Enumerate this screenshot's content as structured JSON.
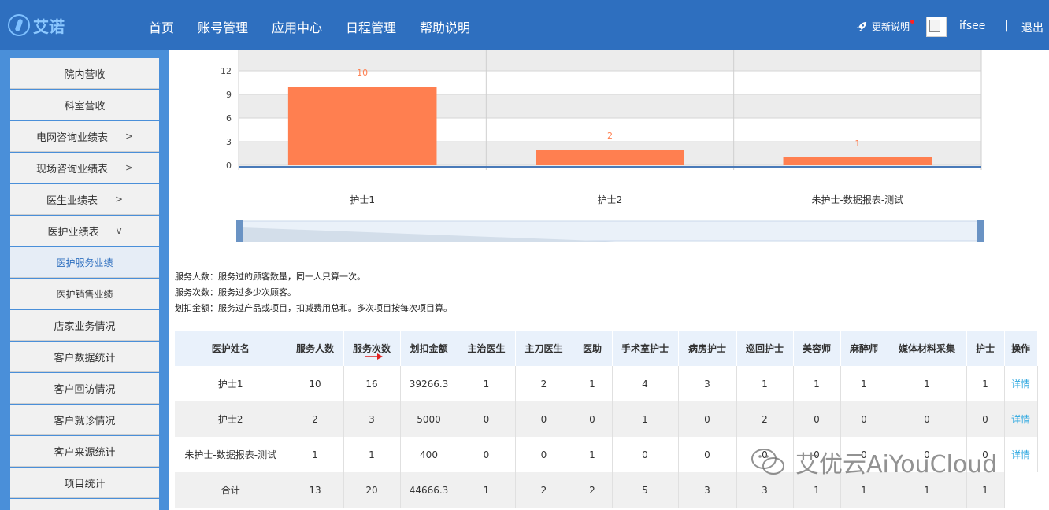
{
  "header": {
    "logo_text": "艾诺",
    "nav": [
      "首页",
      "账号管理",
      "应用中心",
      "日程管理",
      "帮助说明"
    ],
    "update_label": "更新说明",
    "username": "ifsee",
    "separator": "|",
    "logout_label": "退出",
    "brand_color": "#2e6fbf"
  },
  "sidebar": {
    "items": [
      {
        "label": "院内营收",
        "chevron": ""
      },
      {
        "label": "科室营收",
        "chevron": ""
      },
      {
        "label": "电网咨询业绩表",
        "chevron": ">"
      },
      {
        "label": "现场咨询业绩表",
        "chevron": ">"
      },
      {
        "label": "医生业绩表",
        "chevron": ">"
      },
      {
        "label": "医护业绩表",
        "chevron": "v"
      },
      {
        "label": "医护服务业绩",
        "chevron": "",
        "active": true
      },
      {
        "label": "医护销售业绩",
        "chevron": ""
      },
      {
        "label": "店家业务情况",
        "chevron": ""
      },
      {
        "label": "客户数据统计",
        "chevron": ""
      },
      {
        "label": "客户回访情况",
        "chevron": ""
      },
      {
        "label": "客户就诊情况",
        "chevron": ""
      },
      {
        "label": "客户来源统计",
        "chevron": ""
      },
      {
        "label": "项目统计",
        "chevron": ""
      }
    ]
  },
  "chart_data": {
    "type": "bar",
    "categories": [
      "护士1",
      "护士2",
      "朱护士-数据报表-测试"
    ],
    "values": [
      10,
      2,
      1
    ],
    "y_ticks": [
      0,
      3,
      6,
      9,
      12,
      15
    ],
    "ylim": [
      0,
      15
    ],
    "bar_color": "#ff7f50",
    "grid": true,
    "data_labels": true
  },
  "notes": {
    "line1": "服务人数：服务过的顾客数量，同一人只算一次。",
    "line2": "服务次数：服务过多少次顾客。",
    "line3": "划扣金额：服务过产品或项目，扣减费用总和。多次项目按每次项目算。"
  },
  "table": {
    "headers": [
      "医护姓名",
      "服务人数",
      "服务次数",
      "划扣金额",
      "主治医生",
      "主刀医生",
      "医助",
      "手术室护士",
      "病房护士",
      "巡回护士",
      "美容师",
      "麻醉师",
      "媒体材料采集",
      "护士",
      "操作"
    ],
    "rows": [
      [
        "护士1",
        "10",
        "16",
        "39266.3",
        "1",
        "2",
        "1",
        "4",
        "3",
        "1",
        "1",
        "1",
        "1",
        "1",
        "详情"
      ],
      [
        "护士2",
        "2",
        "3",
        "5000",
        "0",
        "0",
        "0",
        "1",
        "0",
        "2",
        "0",
        "0",
        "0",
        "0",
        "详情"
      ],
      [
        "朱护士-数据报表-测试",
        "1",
        "1",
        "400",
        "0",
        "0",
        "1",
        "0",
        "0",
        "0",
        "0",
        "0",
        "0",
        "0",
        "详情"
      ]
    ],
    "total": [
      "合计",
      "13",
      "20",
      "44666.3",
      "1",
      "2",
      "2",
      "5",
      "3",
      "3",
      "1",
      "1",
      "1",
      "1"
    ]
  },
  "watermark": {
    "text": "艾优云AiYouCloud"
  }
}
